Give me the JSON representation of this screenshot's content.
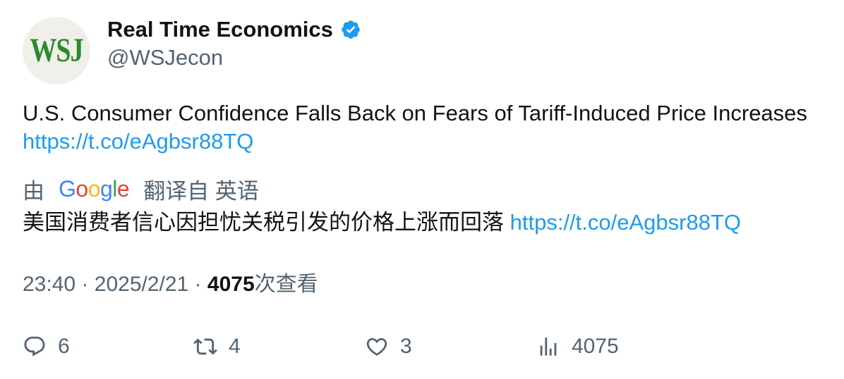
{
  "author": {
    "avatar_text": "WSJ",
    "display_name": "Real Time Economics",
    "handle": "@WSJecon",
    "verified_icon": "verified-badge-icon"
  },
  "tweet": {
    "text": "U.S. Consumer Confidence Falls Back on Fears of Tariff-Induced Price Increases",
    "link": "https://t.co/eAgbsr88TQ"
  },
  "translation": {
    "prefix": "由",
    "provider": "Google",
    "suffix": "翻译自 英语",
    "text": "美国消费者信心因担忧关税引发的价格上涨而回落",
    "link": "https://t.co/eAgbsr88TQ"
  },
  "meta": {
    "time": "23:40",
    "separator": "·",
    "date": "2025/2/21",
    "views_count": "4075",
    "views_label": "次查看"
  },
  "actions": {
    "reply_count": "6",
    "retweet_count": "4",
    "like_count": "3",
    "views_count": "4075"
  },
  "colors": {
    "link": "#1d9bf0",
    "verified": "#1d9bf0",
    "secondary_text": "#536471",
    "primary_text": "#0f1419",
    "avatar_bg": "#f0efe9",
    "avatar_logo": "#2d8a2d"
  }
}
